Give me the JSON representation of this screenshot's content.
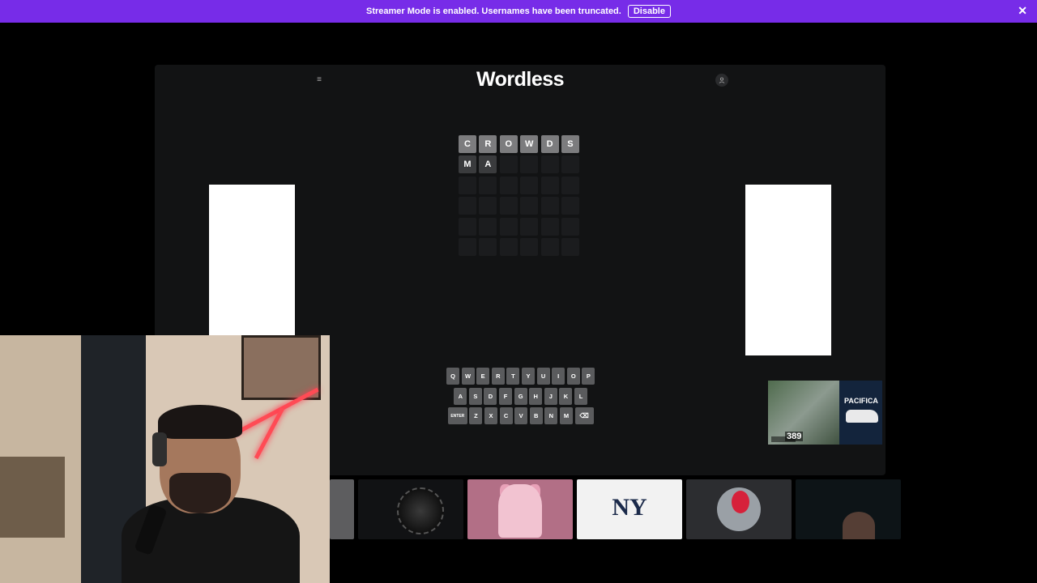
{
  "banner": {
    "message": "Streamer Mode is enabled. Usernames have been truncated.",
    "disable_label": "Disable",
    "close_glyph": "✕",
    "color": "#772ce8"
  },
  "game": {
    "title": "Wordless",
    "menu_glyph": "≡",
    "board": {
      "rows": [
        [
          "C",
          "R",
          "O",
          "W",
          "D",
          "S"
        ],
        [
          "M",
          "A",
          "",
          "",
          "",
          ""
        ],
        [
          "",
          "",
          "",
          "",
          "",
          ""
        ],
        [
          "",
          "",
          "",
          "",
          "",
          ""
        ],
        [
          "",
          "",
          "",
          "",
          "",
          ""
        ],
        [
          "",
          "",
          "",
          "",
          "",
          ""
        ]
      ]
    },
    "keyboard": {
      "row1": [
        "Q",
        "W",
        "E",
        "R",
        "T",
        "Y",
        "U",
        "I",
        "O",
        "P"
      ],
      "row2": [
        "A",
        "S",
        "D",
        "F",
        "G",
        "H",
        "J",
        "K",
        "L"
      ],
      "row3": [
        "ENTER",
        "Z",
        "X",
        "C",
        "V",
        "B",
        "N",
        "M",
        "⌫"
      ]
    }
  },
  "video_ad": {
    "brand": "PACIFICA",
    "price": "389"
  },
  "thumbnails": {
    "yankees_logo": "NY"
  }
}
